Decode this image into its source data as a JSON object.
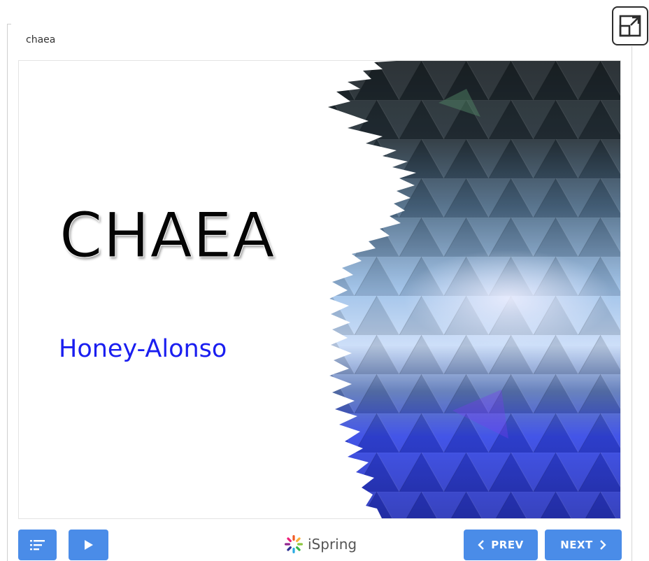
{
  "embed": {
    "title": "chaea"
  },
  "slide": {
    "title": "CHAEA",
    "subtitle": "Honey-Alonso"
  },
  "player": {
    "brand": "iSpring",
    "prev_label": "PREV",
    "next_label": "NEXT"
  },
  "icons": {
    "expand": "expand-icon",
    "menu": "outline-menu-icon",
    "play": "play-icon",
    "prev": "chevron-left-icon",
    "next": "chevron-right-icon",
    "brand": "ispring-logo-icon"
  },
  "colors": {
    "button": "#4a8ce8",
    "subtitle": "#1a1ef0",
    "title": "#050505"
  }
}
